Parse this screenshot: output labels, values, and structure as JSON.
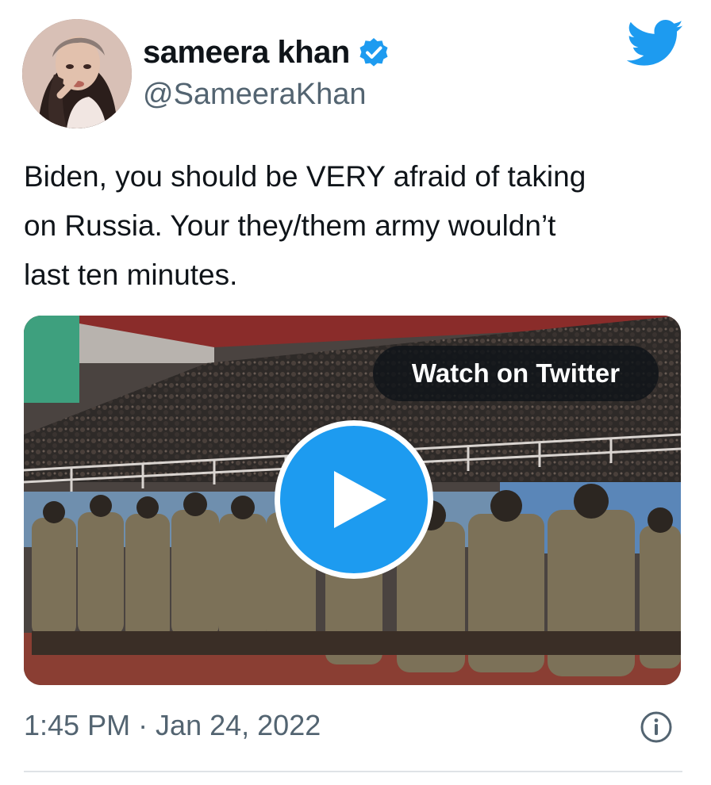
{
  "tweet": {
    "author": {
      "display_name": "sameera khan",
      "handle": "@SameeraKhan",
      "verified": true,
      "avatar_icon": "profile-photo"
    },
    "brand_icon": "twitter-bird-icon",
    "text": "Biden, you should be VERY afraid of taking\non Russia. Your they/them army wouldn’t\nlast ten minutes.",
    "media": {
      "type": "video",
      "watch_label": "Watch on Twitter",
      "play_icon": "play-icon"
    },
    "timestamp": "1:45 PM · Jan 24, 2022",
    "info_icon": "info-icon"
  },
  "colors": {
    "twitter_blue": "#1d9bf0",
    "text": "#0f1419",
    "secondary_text": "#536471",
    "divider": "#dfe3e6"
  }
}
